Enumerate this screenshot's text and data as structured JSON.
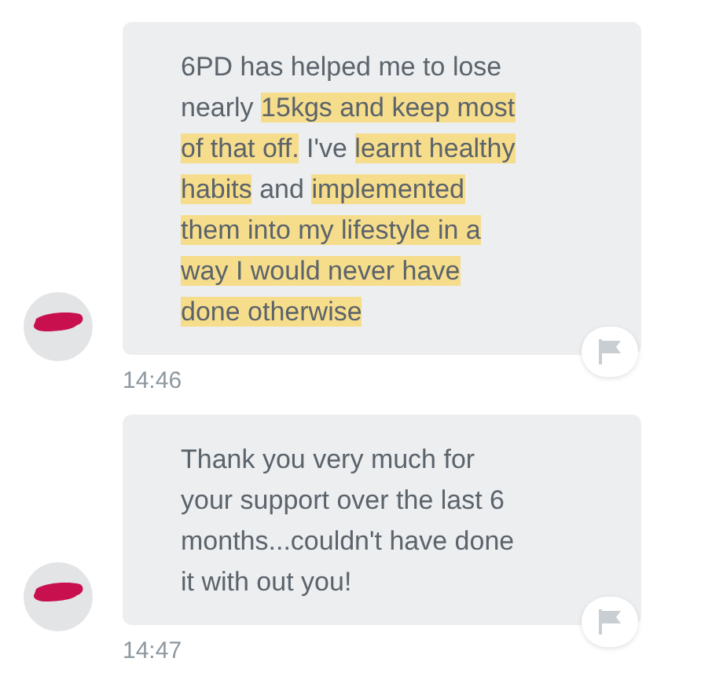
{
  "messages": [
    {
      "lines": [
        [
          {
            "text": "6PD has helped me to lose",
            "highlighted": false
          }
        ],
        [
          {
            "text": "nearly ",
            "highlighted": false
          },
          {
            "text": "15kgs and keep most",
            "highlighted": true
          }
        ],
        [
          {
            "text": "of that off.",
            "highlighted": true
          },
          {
            "text": " I've ",
            "highlighted": false
          },
          {
            "text": "learnt healthy",
            "highlighted": true
          }
        ],
        [
          {
            "text": "habits",
            "highlighted": true
          },
          {
            "text": " and ",
            "highlighted": false
          },
          {
            "text": "implemented",
            "highlighted": true
          }
        ],
        [
          {
            "text": "them into my lifestyle in a",
            "highlighted": true
          }
        ],
        [
          {
            "text": "way I would never have",
            "highlighted": true
          }
        ],
        [
          {
            "text": "done otherwise",
            "highlighted": true
          }
        ]
      ],
      "time": "14:46"
    },
    {
      "lines": [
        [
          {
            "text": "Thank you very much for",
            "highlighted": false
          }
        ],
        [
          {
            "text": "your support over the last 6",
            "highlighted": false
          }
        ],
        [
          {
            "text": "months...couldn't have done",
            "highlighted": false
          }
        ],
        [
          {
            "text": "it with out you!",
            "highlighted": false
          }
        ]
      ],
      "time": "14:47"
    }
  ]
}
